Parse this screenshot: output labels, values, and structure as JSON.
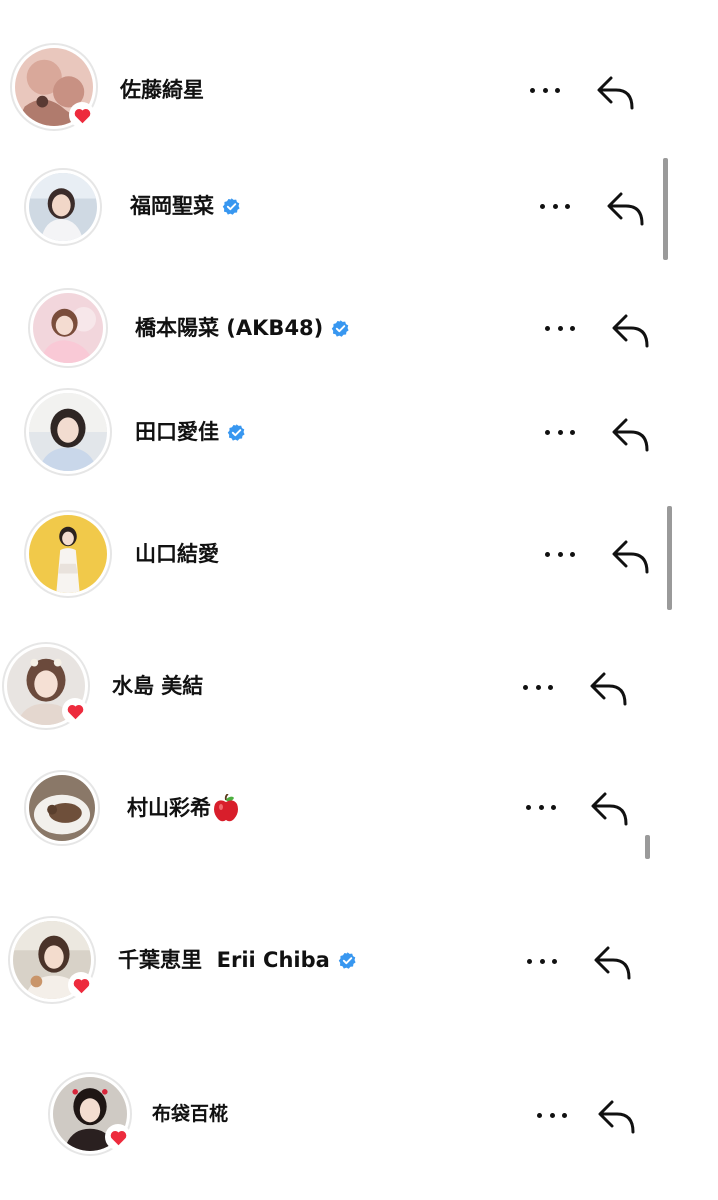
{
  "colors": {
    "verified": "#3897f0",
    "heart": "#ed2b3d",
    "text": "#111111"
  },
  "comments": [
    {
      "name": "佐藤綺星",
      "verified": false,
      "liked_badge": true,
      "emoji": null
    },
    {
      "name": "福岡聖菜",
      "verified": true,
      "liked_badge": false,
      "emoji": null
    },
    {
      "name": "橋本陽菜 (AKB48)",
      "verified": true,
      "liked_badge": false,
      "emoji": null
    },
    {
      "name": "田口愛佳",
      "verified": true,
      "liked_badge": false,
      "emoji": null
    },
    {
      "name": "山口結愛",
      "verified": false,
      "liked_badge": false,
      "emoji": null
    },
    {
      "name": "水島 美結",
      "verified": false,
      "liked_badge": true,
      "emoji": null
    },
    {
      "name": "村山彩希",
      "verified": false,
      "liked_badge": false,
      "emoji": "red-apple-icon"
    },
    {
      "name": "千葉恵里  Erii Chiba",
      "verified": true,
      "liked_badge": true,
      "emoji": null
    },
    {
      "name": "布袋百椛",
      "verified": false,
      "liked_badge": true,
      "emoji": null
    }
  ],
  "icons": {
    "more": "more-options-icon",
    "reply": "reply-arrow-icon",
    "verified": "verified-badge-icon",
    "heart": "heart-icon"
  }
}
